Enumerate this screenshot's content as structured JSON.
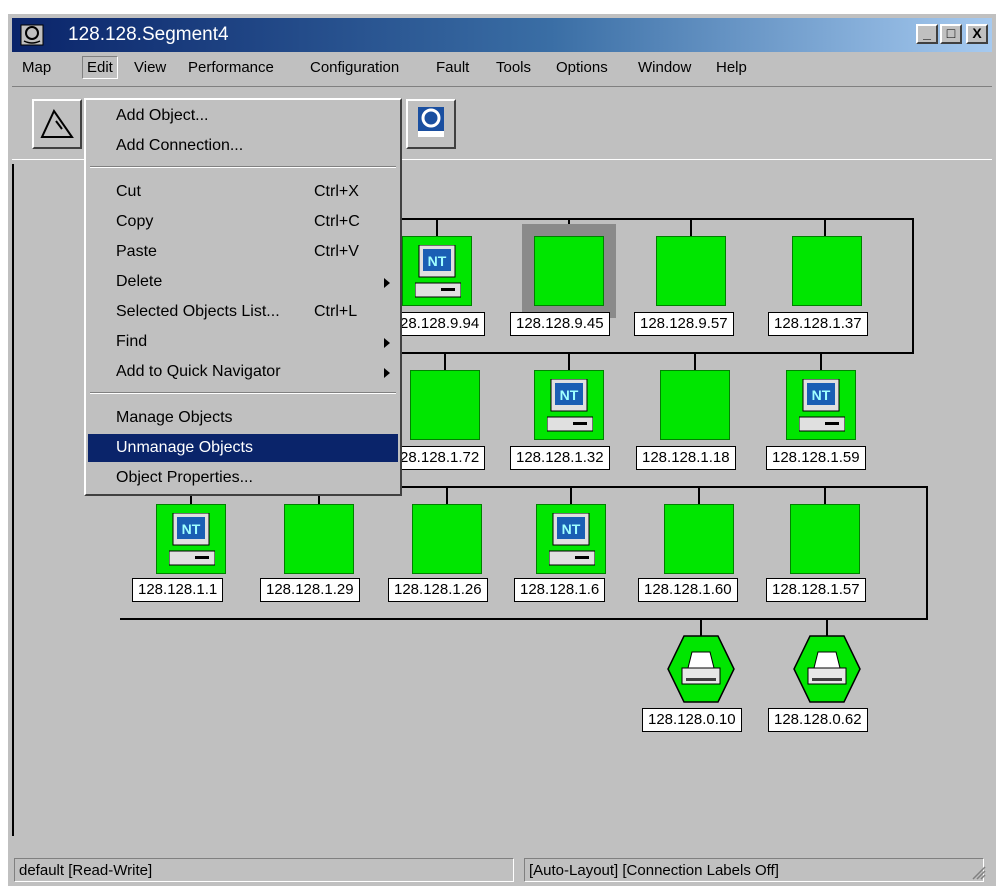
{
  "window": {
    "title": "128.128.Segment4",
    "minimize_label": "_",
    "maximize_label": "□",
    "close_label": "X"
  },
  "menubar": [
    "Map",
    "Edit",
    "View",
    "Performance",
    "Configuration",
    "Fault",
    "Tools",
    "Options",
    "Window",
    "Help"
  ],
  "edit_menu": {
    "items": [
      {
        "label": "Add Object...",
        "shortcut": ""
      },
      {
        "label": "Add Connection...",
        "shortcut": ""
      },
      {
        "label": "Cut",
        "shortcut": "Ctrl+X"
      },
      {
        "label": "Copy",
        "shortcut": "Ctrl+C"
      },
      {
        "label": "Paste",
        "shortcut": "Ctrl+V"
      },
      {
        "label": "Delete",
        "shortcut": ""
      },
      {
        "label": "Selected Objects List...",
        "shortcut": "Ctrl+L"
      },
      {
        "label": "Find",
        "shortcut": ""
      },
      {
        "label": "Add to Quick Navigator",
        "shortcut": ""
      },
      {
        "label": "Manage Objects",
        "shortcut": ""
      },
      {
        "label": "Unmanage Objects",
        "shortcut": ""
      },
      {
        "label": "Object Properties...",
        "shortcut": ""
      }
    ],
    "highlighted": "Unmanage Objects"
  },
  "map": {
    "row1": [
      "28.128.9.94",
      "128.128.9.45",
      "128.128.9.57",
      "128.128.1.37"
    ],
    "row2": [
      "28.128.1.72",
      "128.128.1.32",
      "128.128.1.18",
      "128.128.1.59"
    ],
    "row3": [
      "128.128.1.1",
      "128.128.1.29",
      "128.128.1.26",
      "128.128.1.6",
      "128.128.1.60",
      "128.128.1.57"
    ],
    "printers": [
      "128.128.0.10",
      "128.128.0.62"
    ],
    "nt_badge": "NT",
    "status_color": "#00e600"
  },
  "statusbar": {
    "left": "default [Read-Write]",
    "right": "[Auto-Layout] [Connection Labels Off]"
  }
}
